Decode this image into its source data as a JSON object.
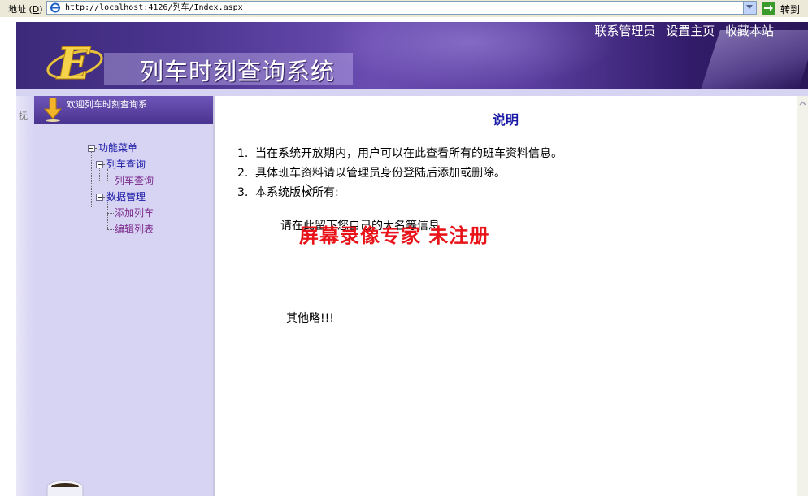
{
  "browser": {
    "address_label": "地址",
    "address_hotkey": "D",
    "url": "http://localhost:4126/列车/Index.aspx",
    "go_label": "转到"
  },
  "header": {
    "title": "列车时刻查询系统",
    "logo_letter": "E",
    "links": [
      "联系管理员",
      "设置主页",
      "收藏本站"
    ]
  },
  "sidebar": {
    "edge_char": "抚",
    "welcome": "欢迎列车时刻查询系",
    "menu_root": "功能菜单",
    "groups": [
      {
        "label": "列车查询",
        "items": [
          "列车查询"
        ]
      },
      {
        "label": "数据管理",
        "items": [
          "添加列车",
          "编辑列表"
        ]
      }
    ]
  },
  "main": {
    "title": "说明",
    "items": [
      "当在系统开放期内，用户可以在此查看所有的班车资料信息。",
      "具体班车资料请以管理员身份登陆后添加或删除。",
      "本系统版权所有:"
    ],
    "sign_note": "请在此留下您自己的大名等信息",
    "others": "其他略!!!",
    "watermark": "屏幕录像专家  未注册"
  },
  "colors": {
    "banner_purple": "#4a348f",
    "sidebar_lavender": "#d7d3f3",
    "link_blue": "#1a1aa6",
    "link_purple": "#7a2a8a",
    "watermark_red": "#e8141a"
  }
}
